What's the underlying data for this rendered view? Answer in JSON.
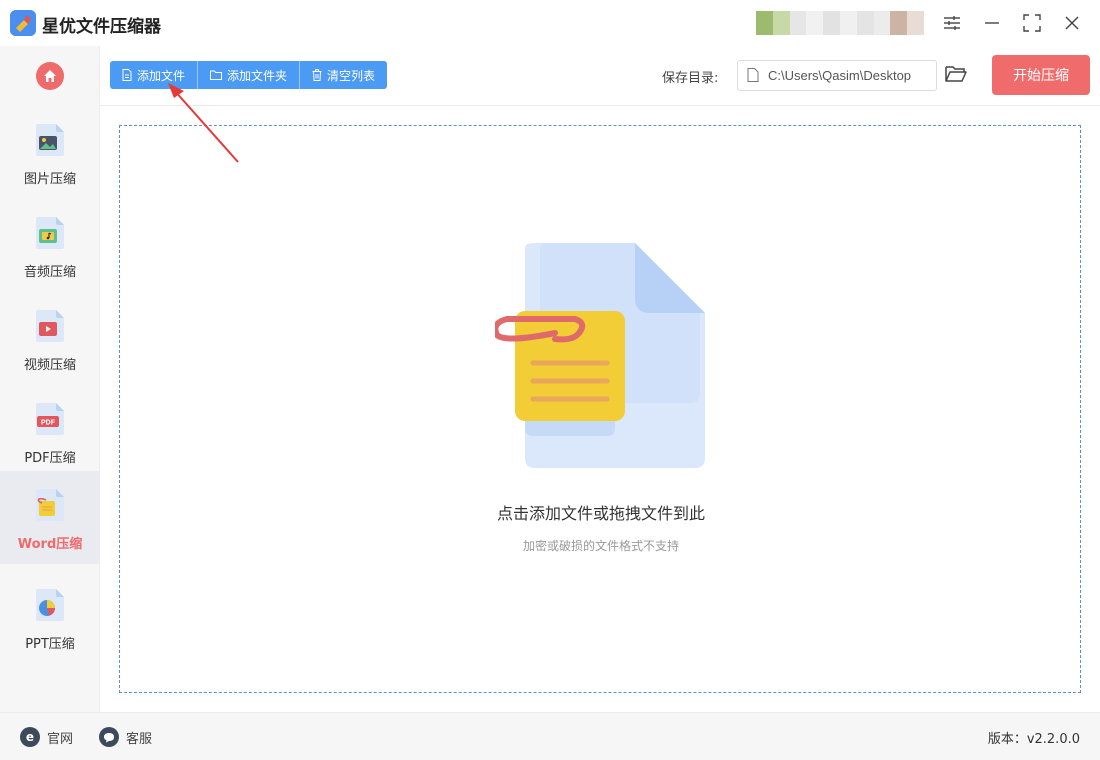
{
  "app": {
    "title": "星优文件压缩器"
  },
  "colors": {
    "accent_blue": "#4b9af3",
    "accent_red": "#f06c6c",
    "sidebar_bg": "#f6f6f7"
  },
  "sidebar": {
    "items": [
      {
        "label": "图片压缩",
        "icon": "image-file-icon"
      },
      {
        "label": "音频压缩",
        "icon": "audio-file-icon"
      },
      {
        "label": "视频压缩",
        "icon": "video-file-icon"
      },
      {
        "label": "PDF压缩",
        "icon": "pdf-file-icon"
      },
      {
        "label": "Word压缩",
        "icon": "word-file-icon",
        "active": true
      },
      {
        "label": "PPT压缩",
        "icon": "ppt-file-icon"
      }
    ]
  },
  "toolbar": {
    "add_file": "添加文件",
    "add_folder": "添加文件夹",
    "clear_list": "清空列表",
    "save_label": "保存目录:",
    "save_path": "C:\\Users\\Qasim\\Desktop",
    "start": "开始压缩"
  },
  "dropzone": {
    "main_text": "点击添加文件或拖拽文件到此",
    "sub_text": "加密或破损的文件格式不支持"
  },
  "footer": {
    "website": "官网",
    "support": "客服",
    "version": "版本：v2.2.0.0"
  }
}
